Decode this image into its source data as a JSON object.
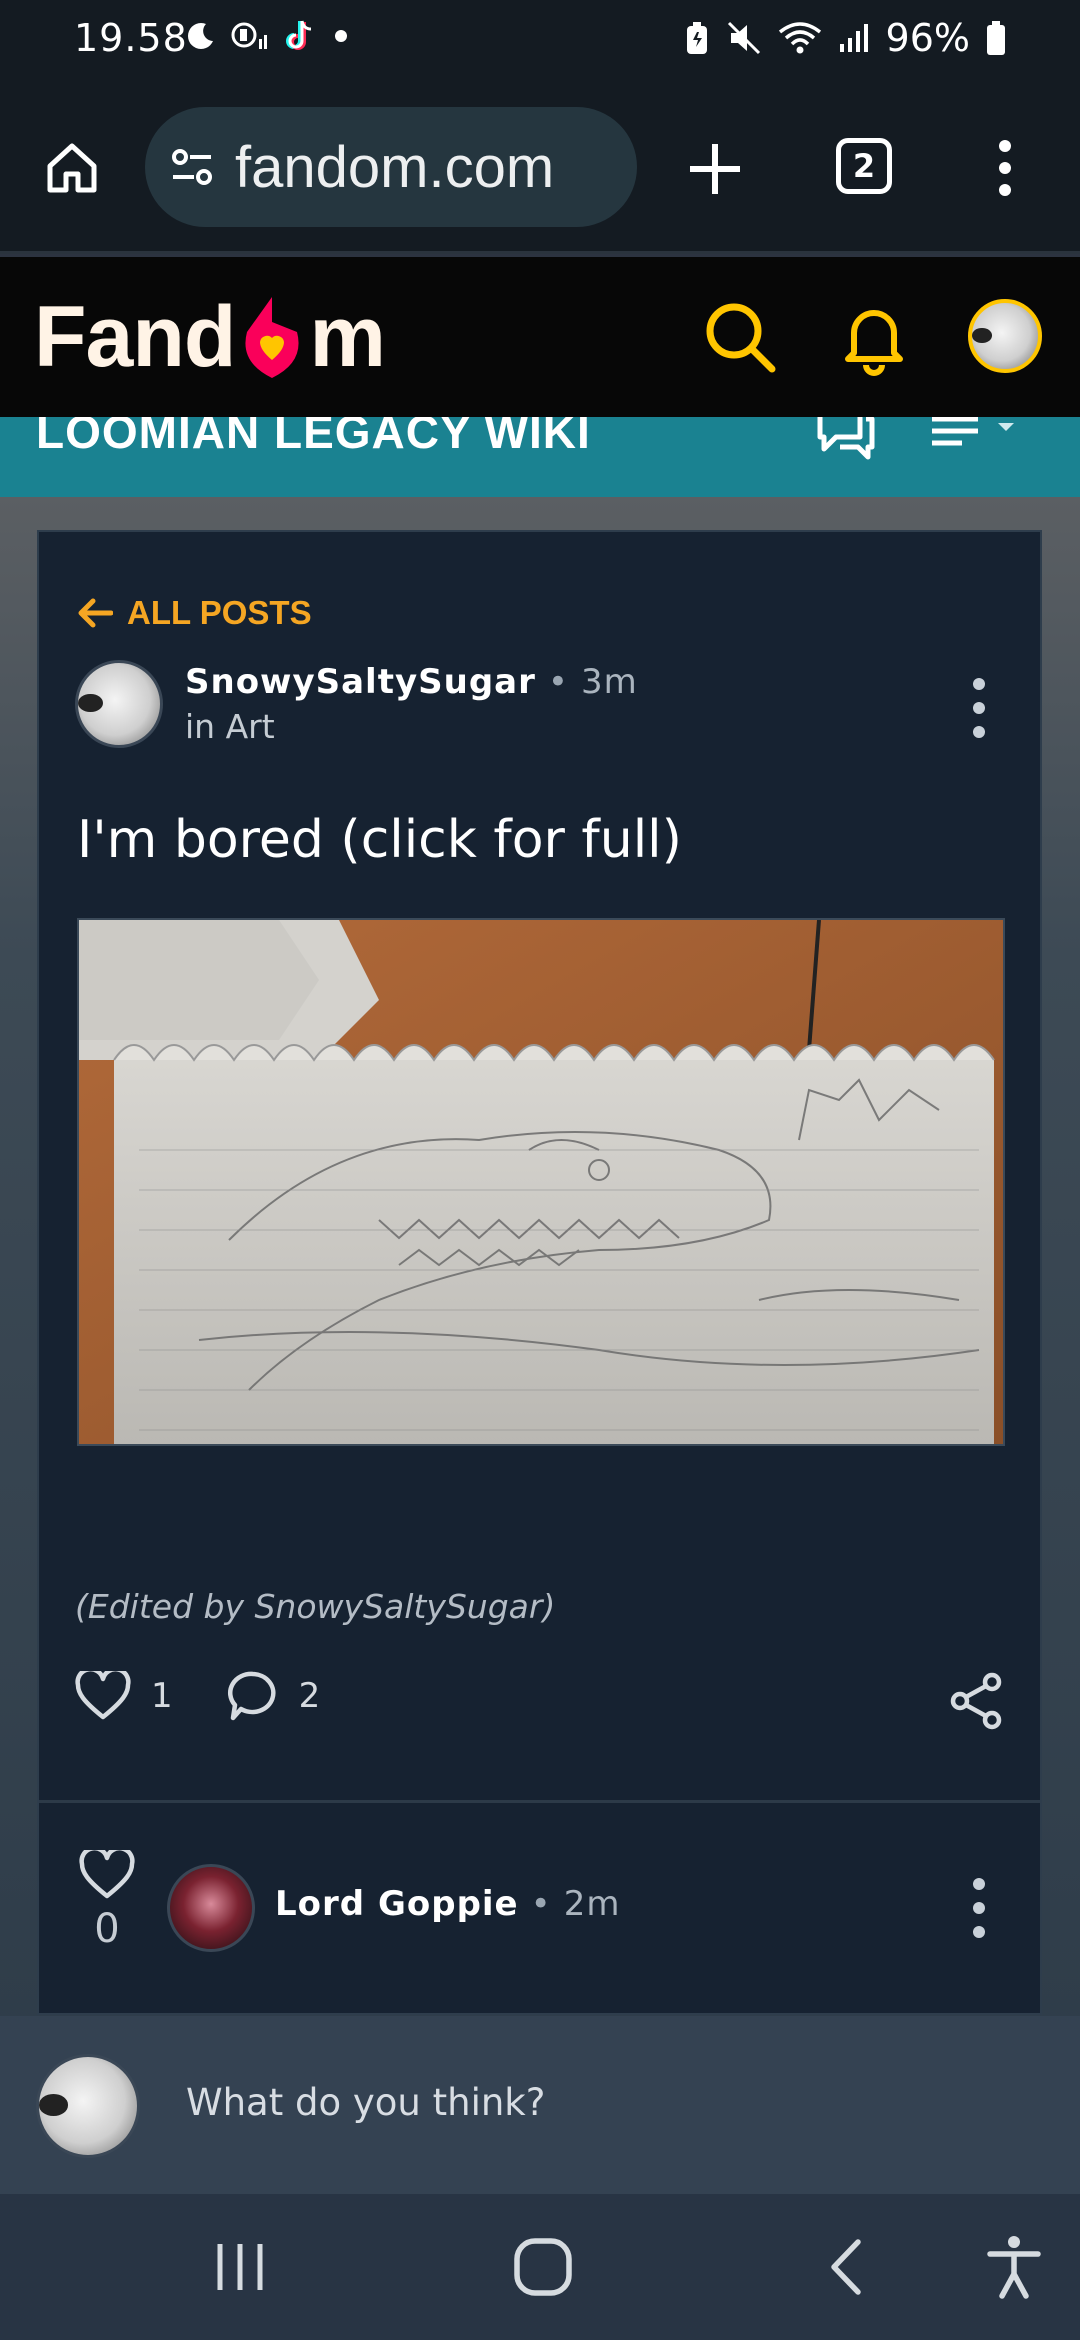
{
  "status_bar": {
    "time": "19.58",
    "battery": "96%",
    "icons": [
      "moon-icon",
      "signal-app-icon",
      "tiktok-icon",
      "dot-icon",
      "battery-saver-icon",
      "mute-icon",
      "wifi-icon",
      "cell-signal-icon",
      "battery-icon"
    ]
  },
  "browser": {
    "url": "fandom.com",
    "tab_count": "2",
    "icons": [
      "home-icon",
      "site-settings-icon",
      "plus-icon",
      "tabs-icon",
      "more-vert-icon"
    ]
  },
  "fandom_header": {
    "logo_text_left": "Fand",
    "logo_text_right": "m",
    "icons": [
      "search-icon",
      "bell-icon",
      "user-avatar"
    ]
  },
  "wiki_bar": {
    "title": "LOOMIAN LEGACY WIKI",
    "icons": [
      "discussions-icon",
      "menu-icon"
    ]
  },
  "post": {
    "back_label": "ALL POSTS",
    "author": "SnowySaltySugar",
    "time": "3m",
    "category": "in Art",
    "title": "I'm bored (click for full)",
    "image_alt": "pencil drawing of a crocodile head on notebook paper",
    "edited_note": "(Edited by SnowySaltySugar)",
    "likes": "1",
    "comments": "2"
  },
  "reply": {
    "likes": "0",
    "author": "Lord Goppie",
    "time": "2m"
  },
  "comment_bar": {
    "placeholder": "What do you think?"
  },
  "nav_bar": {
    "icons": [
      "recents-icon",
      "home-circle-icon",
      "back-icon",
      "accessibility-icon"
    ]
  },
  "colors": {
    "accent": "#f5a623",
    "wiki_bar": "#1a8291",
    "card_bg": "#162231"
  }
}
